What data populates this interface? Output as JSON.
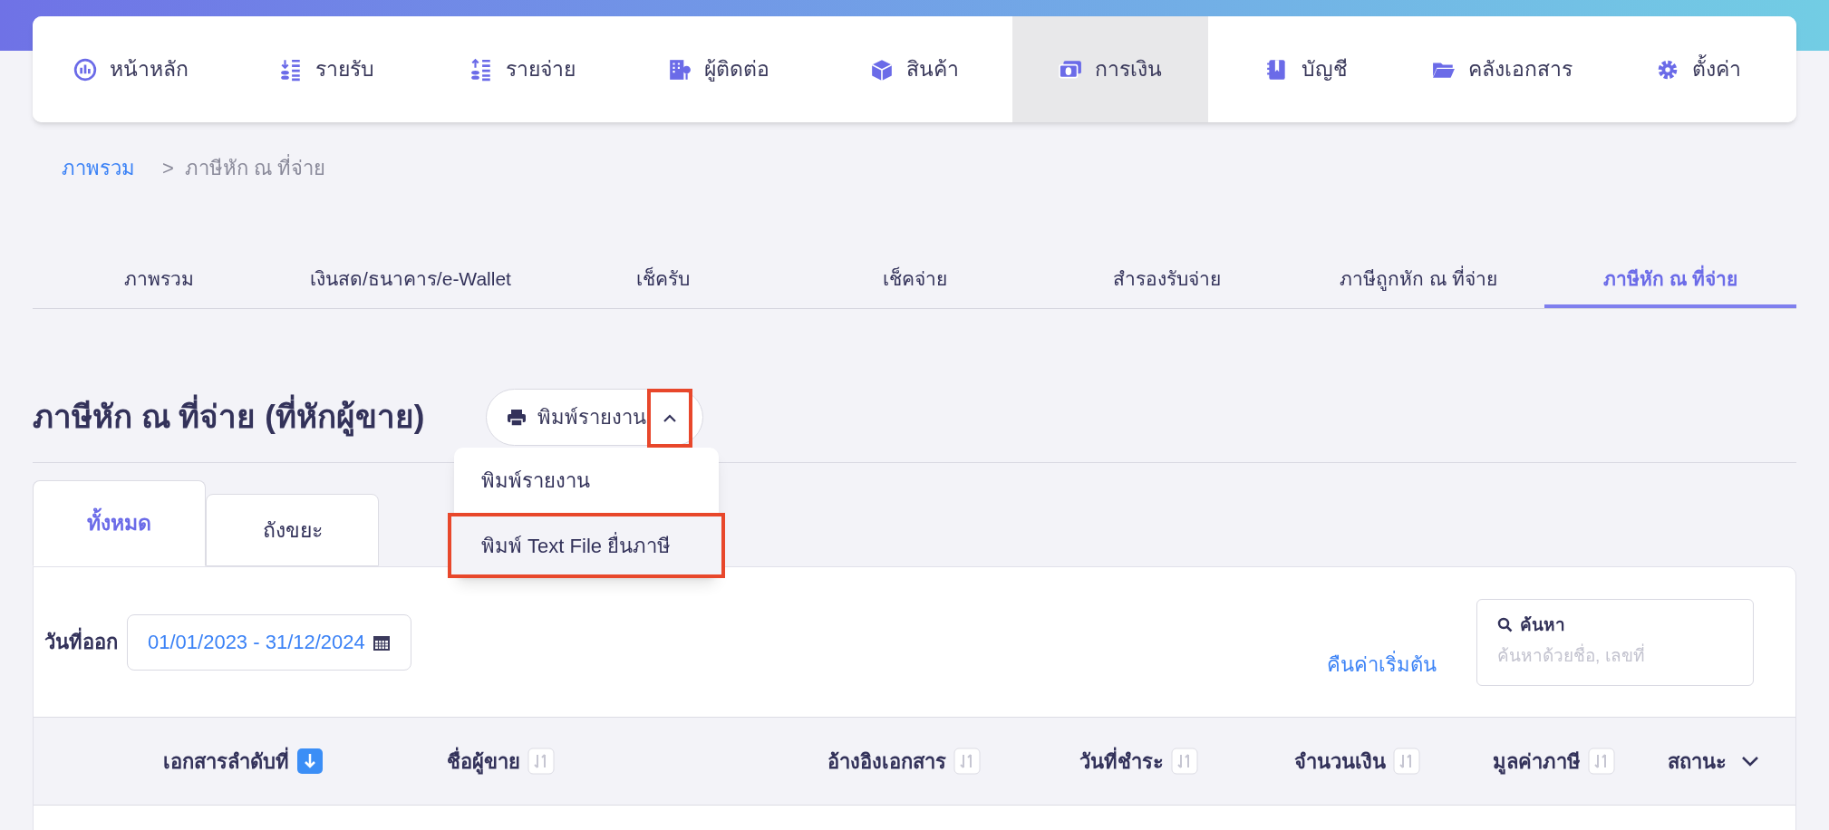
{
  "nav": [
    {
      "label": "หน้าหลัก",
      "kind": "gauge",
      "selected": false
    },
    {
      "label": "รายรับ",
      "kind": "income",
      "selected": false
    },
    {
      "label": "รายจ่าย",
      "kind": "expense",
      "selected": false
    },
    {
      "label": "ผู้ติดต่อ",
      "kind": "contact",
      "selected": false
    },
    {
      "label": "สินค้า",
      "kind": "product",
      "selected": false
    },
    {
      "label": "การเงิน",
      "kind": "finance",
      "selected": true
    },
    {
      "label": "บัญชี",
      "kind": "account",
      "selected": false
    },
    {
      "label": "คลังเอกสาร",
      "kind": "docs",
      "selected": false
    },
    {
      "label": "ตั้งค่า",
      "kind": "settings",
      "selected": false
    }
  ],
  "breadcrumb": {
    "link": "ภาพรวม",
    "separator": ">",
    "current": "ภาษีหัก ณ ที่จ่าย"
  },
  "section_tabs": [
    {
      "label": "ภาพรวม",
      "selected": false
    },
    {
      "label": "เงินสด/ธนาคาร/e-Wallet",
      "selected": false
    },
    {
      "label": "เช็ครับ",
      "selected": false
    },
    {
      "label": "เช็คจ่าย",
      "selected": false
    },
    {
      "label": "สำรองรับจ่าย",
      "selected": false
    },
    {
      "label": "ภาษีถูกหัก ณ ที่จ่าย",
      "selected": false
    },
    {
      "label": "ภาษีหัก ณ ที่จ่าย",
      "selected": true
    }
  ],
  "page_title": "ภาษีหัก ณ ที่จ่าย (ที่หักผู้ขาย)",
  "print_button": {
    "label": "พิมพ์รายงาน",
    "expanded": true,
    "caret_highlighted": true
  },
  "print_menu": [
    {
      "label": "พิมพ์รายงาน",
      "highlighted": false
    },
    {
      "label": "พิมพ์ Text File ยื่นภาษี",
      "highlighted": true
    }
  ],
  "list_tabs": [
    {
      "label": "ทั้งหมด",
      "selected": true
    },
    {
      "label": "ถังขยะ",
      "selected": false
    }
  ],
  "filters": {
    "date_label": "วันที่ออก",
    "date_range": "01/01/2023 - 31/12/2024",
    "reset_link": "คืนค่าเริ่มต้น",
    "search_label": "ค้นหา",
    "search_placeholder": "ค้นหาด้วยชื่อ, เลขที่"
  },
  "table": {
    "columns": [
      {
        "label": "เอกสารลำดับที่",
        "sort_active": true
      },
      {
        "label": "ชื่อผู้ขาย",
        "sort_active": false
      },
      {
        "label": "อ้างอิงเอกสาร",
        "sort_active": false
      },
      {
        "label": "วันที่ชำระ",
        "sort_active": false
      },
      {
        "label": "จำนวนเงิน",
        "sort_active": false
      },
      {
        "label": "มูลค่าภาษี",
        "sort_active": false
      }
    ],
    "status_column": {
      "label": "สถานะ"
    }
  }
}
